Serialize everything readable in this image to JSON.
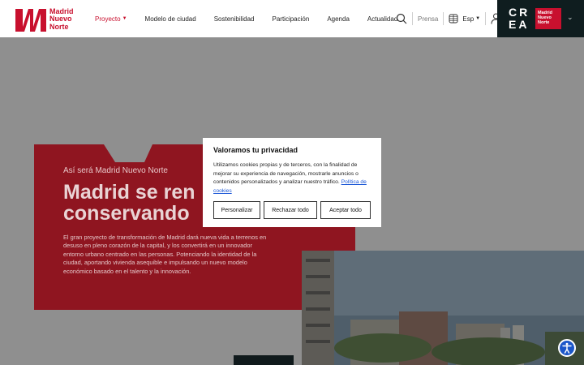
{
  "brand": {
    "logo_text": [
      "Madrid",
      "Nuevo",
      "Norte"
    ],
    "accent": "#c8102e"
  },
  "nav": [
    {
      "label": "Proyecto",
      "active": true
    },
    {
      "label": "Modelo de ciudad"
    },
    {
      "label": "Sostenibilidad"
    },
    {
      "label": "Participación"
    },
    {
      "label": "Agenda"
    },
    {
      "label": "Actualidad"
    }
  ],
  "tools": {
    "prensa": "Prensa",
    "lang": "Esp",
    "icons": [
      "search-icon",
      "globe-icon",
      "user-icon"
    ]
  },
  "crea": {
    "line1": "CR",
    "line2": "EA",
    "badge": [
      "Madrid",
      "Nuevo",
      "Norte"
    ]
  },
  "hero": {
    "eyebrow": "Así será Madrid Nuevo Norte",
    "title_line1": "Madrid se ren",
    "title_line2": "conservando",
    "body": "El gran proyecto de transformación de Madrid dará nueva vida a terrenos en desuso en pleno corazón de la capital, y los convertirá en un innovador entorno urbano centrado en las personas. Potenciando la identidad de la ciudad, aportando vivienda asequible e impulsando un nuevo modelo económico basado en el talento y la innovación."
  },
  "cookie": {
    "title": "Valoramos tu privacidad",
    "text": "Utilizamos cookies propias y de terceros, con la finalidad de mejorar su experiencia de navegación, mostrarle anuncios o contenidos personalizados y analizar nuestro tráfico.",
    "link": "Política de cookies",
    "buttons": {
      "customize": "Personalizar",
      "reject": "Rechazar todo",
      "accept": "Aceptar todo"
    }
  }
}
